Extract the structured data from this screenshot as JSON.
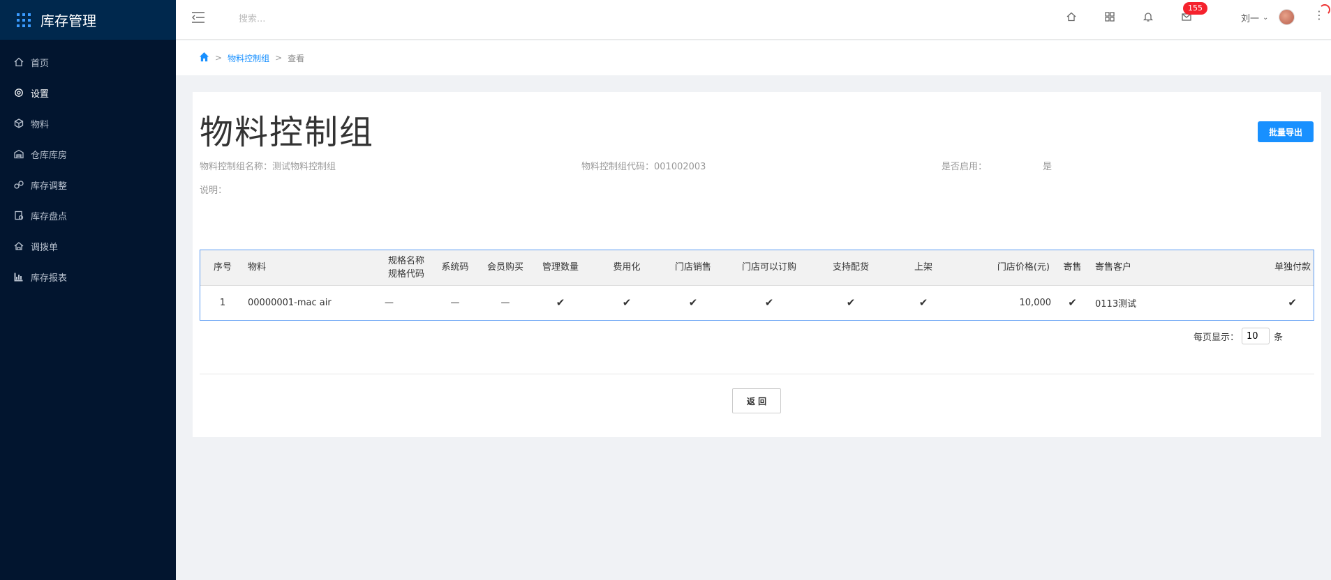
{
  "app": {
    "title": "库存管理"
  },
  "sidebar": {
    "items": [
      {
        "label": "首页",
        "icon": "home-icon"
      },
      {
        "label": "设置",
        "icon": "gear-icon"
      },
      {
        "label": "物料",
        "icon": "cube-icon"
      },
      {
        "label": "仓库库房",
        "icon": "warehouse-icon"
      },
      {
        "label": "库存调整",
        "icon": "adjust-icon"
      },
      {
        "label": "库存盘点",
        "icon": "checklist-icon"
      },
      {
        "label": "调拨单",
        "icon": "transfer-icon"
      },
      {
        "label": "库存报表",
        "icon": "bar-chart-icon"
      }
    ],
    "active": "设置"
  },
  "header": {
    "search_placeholder": "搜索...",
    "badge_count": "155",
    "user_name": "刘一"
  },
  "breadcrumb": {
    "link": "物料控制组",
    "current": "查看"
  },
  "page": {
    "title": "物料控制组",
    "export_label": "批量导出",
    "name_label": "物料控制组名称：",
    "name_value": "测试物料控制组",
    "code_label": "物料控制组代码：",
    "code_value": "001002003",
    "enabled_label": "是否启用：",
    "enabled_value": "是",
    "desc_label": "说明："
  },
  "table": {
    "headers": [
      "序号",
      "物料",
      "规格名称",
      "规格代码",
      "系统码",
      "会员购买",
      "管理数量",
      "费用化",
      "门店销售",
      "门店可以订购",
      "支持配货",
      "上架",
      "门店价格(元)",
      "寄售",
      "寄售客户",
      "单独付款"
    ],
    "rows": [
      {
        "index": "1",
        "material": "00000001-mac air",
        "spec": "—",
        "system_code": "—",
        "member_buy": "—",
        "manage_qty": "✔",
        "expense": "✔",
        "store_sale": "✔",
        "store_order": "✔",
        "distribution": "✔",
        "shelf": "✔",
        "price": "10,000",
        "consign": "✔",
        "consign_customer": "0113测试",
        "separate_pay": "✔"
      }
    ]
  },
  "pager": {
    "label": "每页显示：",
    "value": "10",
    "unit": "条"
  },
  "footer": {
    "back_label": "返 回"
  },
  "colors": {
    "sidebar_bg": "#02152f",
    "accent": "#1890ff",
    "badge": "#f5222d"
  }
}
